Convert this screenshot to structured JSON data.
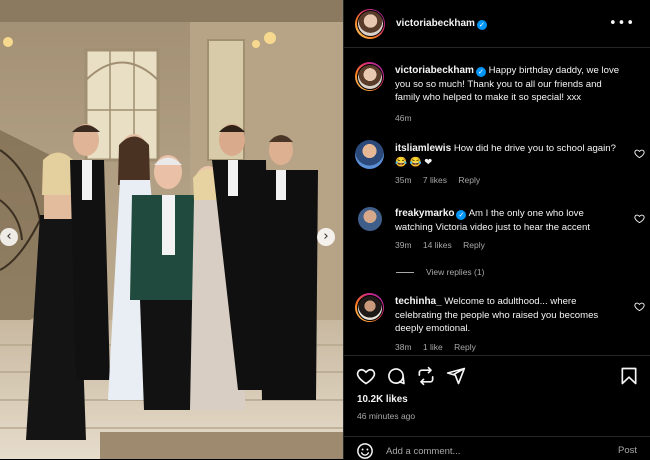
{
  "post": {
    "author": "victoriabeckham",
    "verified": true,
    "likes": "10.2K likes",
    "time_ago": "46 minutes ago",
    "caption": {
      "username": "victoriabeckham",
      "text": "Happy birthday daddy, we love you so so much! Thank you to all our friends and family who helped to make it so special! xxx",
      "time": "46m"
    },
    "comments": [
      {
        "username": "itsliamlewis",
        "text": "How did he drive you to school again? 😂 😂 ❤",
        "time": "35m",
        "likes": "7 likes",
        "reply_label": "Reply"
      },
      {
        "username": "freakymarko",
        "verified": true,
        "text": "Am I the only one who love watching Victoria video just to hear the accent",
        "time": "39m",
        "likes": "14 likes",
        "reply_label": "Reply",
        "view_replies": "View replies (1)"
      },
      {
        "username": "techinha_",
        "text": "Welcome to adulthood... where celebrating the people who raised you becomes deeply emotional.",
        "time": "38m",
        "likes": "1 like",
        "reply_label": "Reply"
      }
    ],
    "add_comment_placeholder": "Add a comment...",
    "post_label": "Post",
    "more_label": "•••"
  },
  "carousel": {
    "prev": "‹",
    "next": "›"
  },
  "icons": {
    "like": "heart-icon",
    "comment": "comment-icon",
    "share": "share-icon",
    "send": "send-icon",
    "save": "bookmark-icon",
    "emoji": "emoji-icon",
    "verified": "verified-badge-icon"
  },
  "colors": {
    "accent": "#0095f6",
    "heart": "#ed4956",
    "muted": "#a8a8a8",
    "background": "#000000"
  }
}
